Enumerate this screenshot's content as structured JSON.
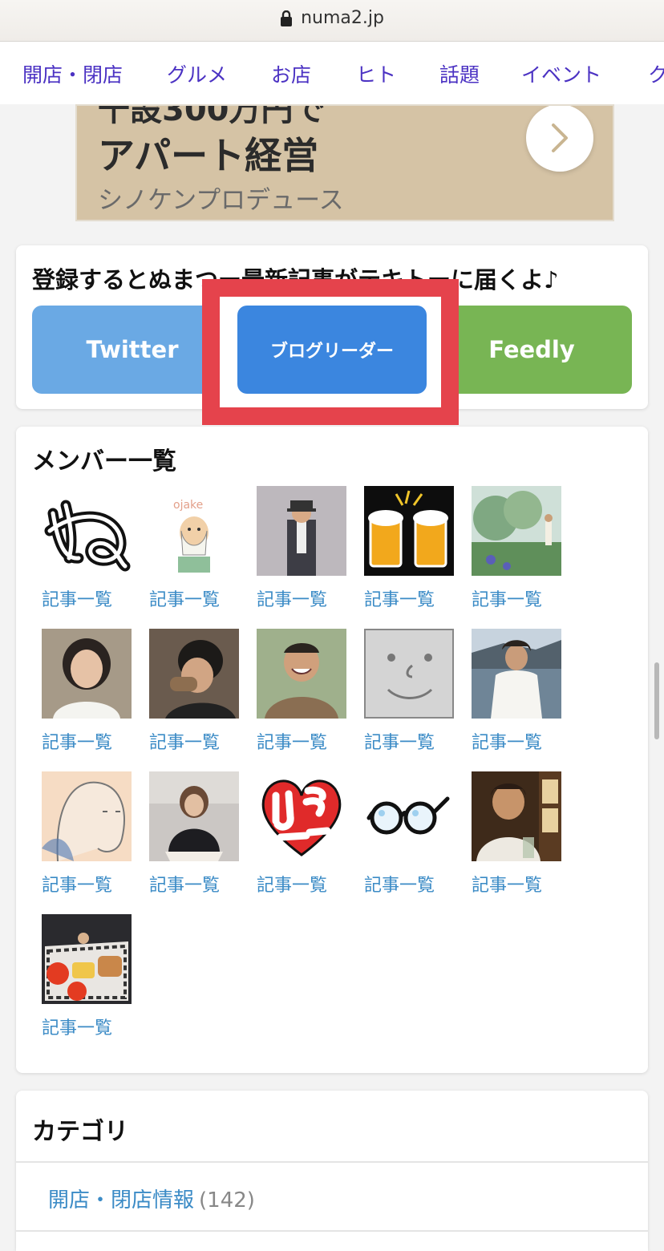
{
  "browser": {
    "url": "numa2.jp"
  },
  "nav": {
    "items": [
      "開店・閉店",
      "グルメ",
      "お店",
      "ヒト",
      "話題",
      "イベント",
      "ク"
    ]
  },
  "ad": {
    "clipped_text": "千設300万円で",
    "title": "アパート経営",
    "sponsor": "シノケンプロデュース"
  },
  "subscribe": {
    "heading": "登録するとぬまつー最新記事がテキトーに届くよ♪",
    "twitter_label": "Twitter",
    "blogreader_label": "ブログリーダー",
    "feedly_label": "Feedly",
    "colors": {
      "twitter": "#6aa9e4",
      "blogreader": "#3b86df",
      "feedly": "#78b554",
      "highlight": "#e5434c"
    }
  },
  "members": {
    "heading": "メンバー一覧",
    "link_label": "記事一覧",
    "avatars": [
      "nu-logo",
      "ojisan-illustration",
      "hat-man-photo",
      "beer-mugs",
      "green-field-photo",
      "woman-smiling-photo",
      "man-eating-photo",
      "man-laughing-photo",
      "smiley-face-icon",
      "woman-seaside-photo",
      "ghost-illustration",
      "woman-sitting-photo",
      "hiraku-logo",
      "glasses-icon",
      "man-bar-photo",
      "food-plate-photo"
    ]
  },
  "category": {
    "heading": "カテゴリ",
    "items": [
      {
        "label": "開店・閉店情報",
        "count": "(142)"
      }
    ]
  }
}
